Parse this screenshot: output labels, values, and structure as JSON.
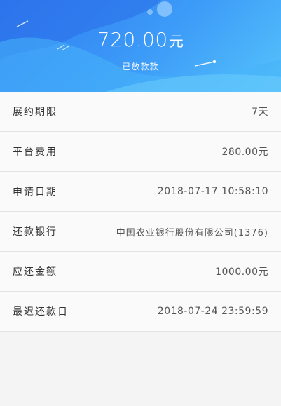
{
  "header": {
    "amount": "720.00",
    "amount_unit": "元",
    "status": "已放款款"
  },
  "details": [
    {
      "label": "展约期限",
      "value": "7天"
    },
    {
      "label": "平台费用",
      "value": "280.00元"
    },
    {
      "label": "申请日期",
      "value": "2018-07-17 10:58:10"
    },
    {
      "label": "还款银行",
      "value": "中国农业银行股份有限公司(1376)"
    },
    {
      "label": "应还金额",
      "value": "1000.00元"
    },
    {
      "label": "最迟还款日",
      "value": "2018-07-24 23:59:59"
    }
  ],
  "colors": {
    "header_gradient_start": "#2f7cf0",
    "header_gradient_end": "#55c2fb",
    "page_background": "#f4f4f4",
    "row_background": "#fafafa",
    "divider": "#e3e3e3"
  }
}
